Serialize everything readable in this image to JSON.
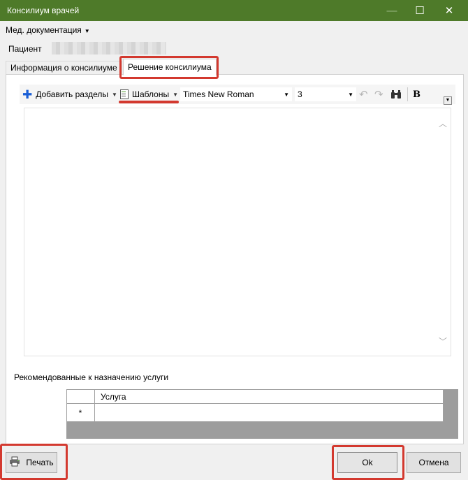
{
  "window": {
    "title": "Консилиум врачей",
    "minimize_glyph": "—",
    "maximize_glyph": "☐",
    "close_glyph": "✕"
  },
  "menu": {
    "med_docs": "Мед. документация"
  },
  "patient": {
    "label": "Пациент"
  },
  "tabs": [
    {
      "label": "Информация о консилиуме"
    },
    {
      "label": "Решение консилиума",
      "active": true
    }
  ],
  "toolbar": {
    "add_sections": "Добавить разделы",
    "templates": "Шаблоны",
    "font_family": "Times New Roman",
    "font_size": "3",
    "bold": "B"
  },
  "services": {
    "label": "Рекомендованные к назначению услуги",
    "column_header": "Услуга",
    "new_row_marker": "*"
  },
  "buttons": {
    "print": "Печать",
    "ok": "Ok",
    "cancel": "Отмена"
  },
  "colors": {
    "titlebar": "#4e7a29",
    "highlight": "#d3392f",
    "plus_icon": "#1a5fd6"
  }
}
